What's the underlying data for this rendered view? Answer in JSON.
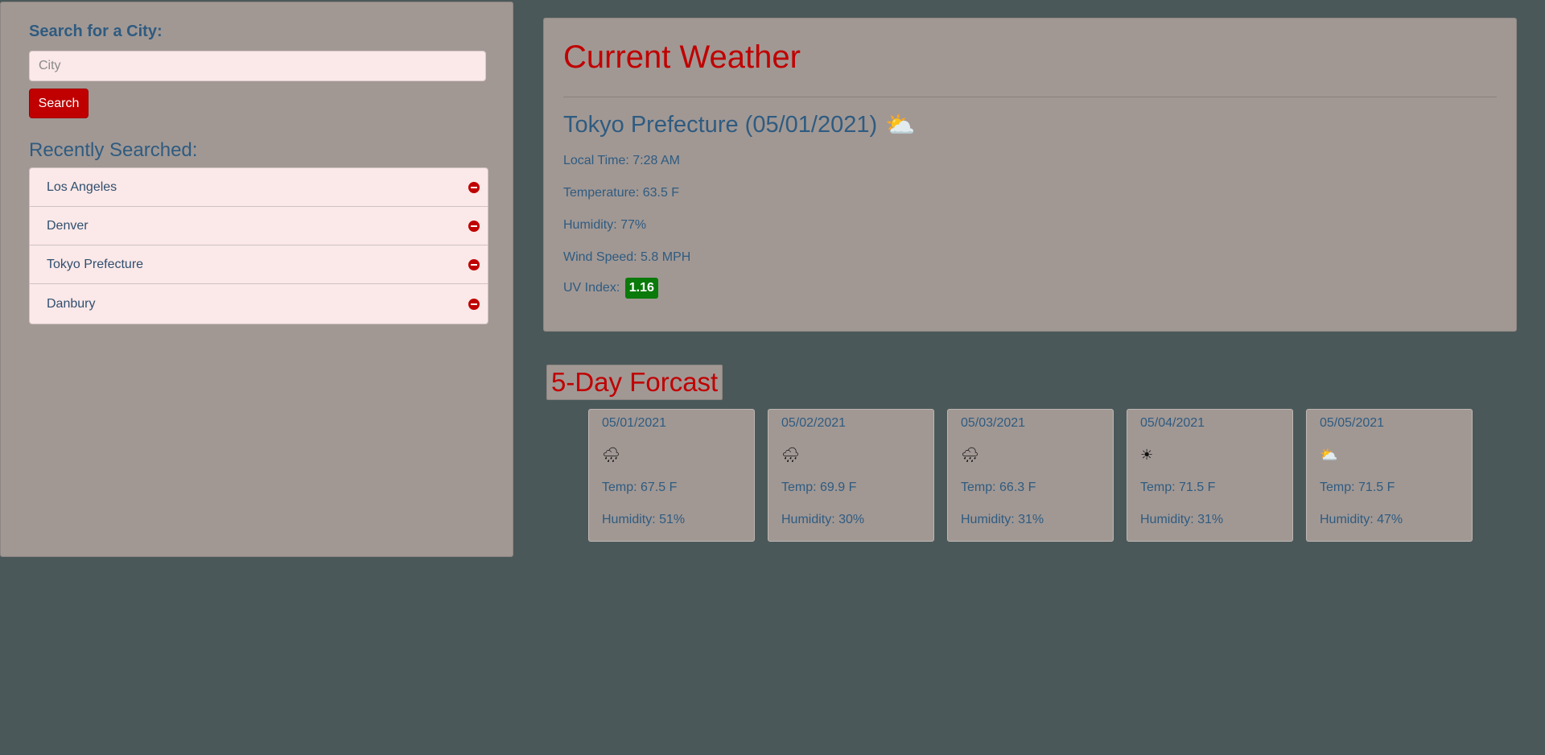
{
  "sidebar": {
    "search_label": "Search for a City:",
    "city_placeholder": "City",
    "search_button": "Search",
    "recent_title": "Recently Searched:",
    "recent": [
      "Los Angeles",
      "Denver",
      "Tokyo Prefecture",
      "Danbury"
    ],
    "remove_icon": "minus-circle-icon"
  },
  "current": {
    "title": "Current Weather",
    "city": "Tokyo Prefecture (05/01/2021)",
    "icon": "⛅",
    "icon_name": "partly-cloudy-icon",
    "local_time": "Local Time: 7:28 AM",
    "temperature": "Temperature: 63.5 F",
    "humidity": "Humidity: 77%",
    "wind": "Wind Speed: 5.8 MPH",
    "uv_label": "UV Index:",
    "uv_value": "1.16",
    "uv_color": "#0a7a0a"
  },
  "forecast": {
    "title": "5-Day Forcast",
    "days": [
      {
        "date": "05/01/2021",
        "icon": "🌧",
        "icon_name": "rain-icon",
        "temp": "Temp: 67.5 F",
        "humidity": "Humidity: 51%"
      },
      {
        "date": "05/02/2021",
        "icon": "🌧",
        "icon_name": "rain-icon",
        "temp": "Temp: 69.9 F",
        "humidity": "Humidity: 30%"
      },
      {
        "date": "05/03/2021",
        "icon": "🌧",
        "icon_name": "rain-icon",
        "temp": "Temp: 66.3 F",
        "humidity": "Humidity: 31%"
      },
      {
        "date": "05/04/2021",
        "icon": "☀",
        "icon_name": "sun-icon",
        "temp": "Temp: 71.5 F",
        "humidity": "Humidity: 31%"
      },
      {
        "date": "05/05/2021",
        "icon": "⛅",
        "icon_name": "partly-cloudy-icon",
        "temp": "Temp: 71.5 F",
        "humidity": "Humidity: 47%"
      }
    ]
  },
  "colors": {
    "background": "#4b5859",
    "panel": "#a19894",
    "accent_red": "#c00000",
    "text_blue": "#2f5b80",
    "list_bg": "#fbe8e8"
  }
}
